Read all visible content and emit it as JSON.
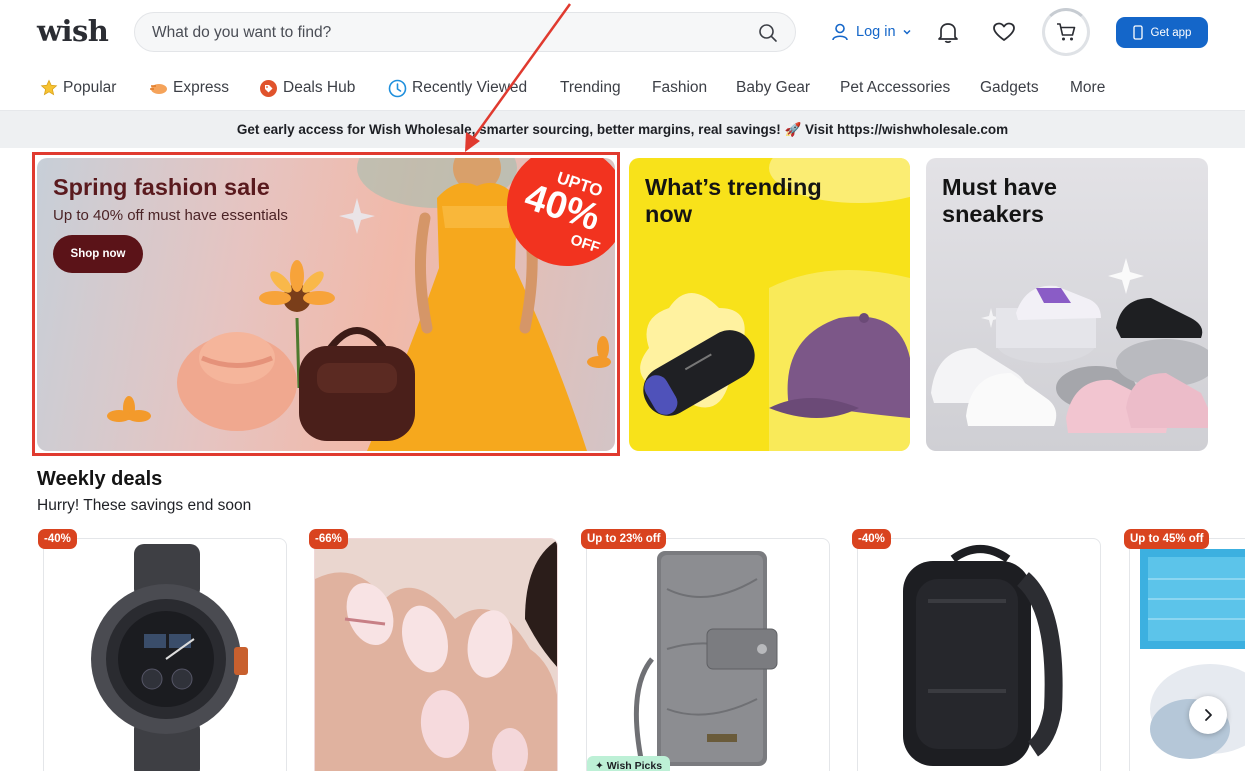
{
  "header": {
    "logo": "wish",
    "search_placeholder": "What do you want to find?",
    "login_label": "Log in",
    "get_app_label": "Get app"
  },
  "nav": {
    "items": [
      {
        "label": "Popular",
        "icon": "star-icon"
      },
      {
        "label": "Express",
        "icon": "express-icon"
      },
      {
        "label": "Deals Hub",
        "icon": "deals-tag-icon"
      },
      {
        "label": "Recently Viewed",
        "icon": "clock-icon"
      },
      {
        "label": "Trending"
      },
      {
        "label": "Fashion"
      },
      {
        "label": "Baby Gear"
      },
      {
        "label": "Pet Accessories"
      },
      {
        "label": "Gadgets"
      },
      {
        "label": "More"
      }
    ]
  },
  "promo_text": "Get early access for Wish Wholesale, smarter sourcing, better margins, real savings! 🚀 Visit https://wishwholesale.com",
  "banners": [
    {
      "title": "Spring fashion sale",
      "subtitle": "Up to 40% off must have essentials",
      "button": "Shop now",
      "badge_upto": "UPTO",
      "badge_pct": "40%",
      "badge_off": "OFF"
    },
    {
      "title": "What’s trending now"
    },
    {
      "title": "Must have sneakers"
    }
  ],
  "weekly_deals": {
    "title": "Weekly deals",
    "subtitle": "Hurry! These savings end soon",
    "cards": [
      {
        "badge": "-40%",
        "product": "watch"
      },
      {
        "badge": "-66%",
        "product": "press-on nails"
      },
      {
        "badge": "Up to 23% off",
        "product": "wallet",
        "tag": "✦ Wish Picks"
      },
      {
        "badge": "-40%",
        "product": "backpack"
      },
      {
        "badge": "Up to 45% off",
        "product": "blue towels"
      }
    ]
  },
  "colors": {
    "brand_blue": "#1466c9",
    "deal_badge": "#d9431f",
    "highlight": "#e03a2f"
  }
}
